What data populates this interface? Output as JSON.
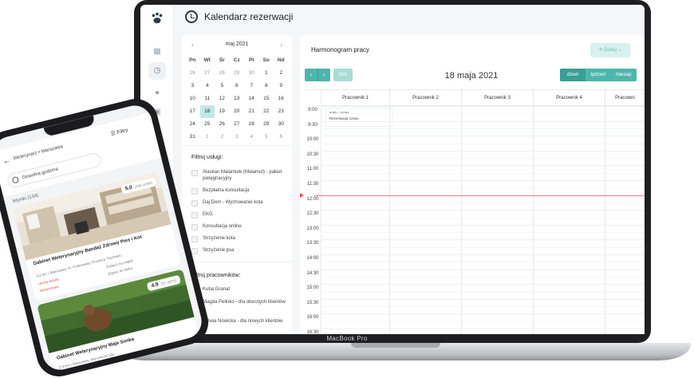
{
  "laptop": {
    "brand": "MacBook Pro",
    "header_title": "Kalendarz rezerwacji",
    "calendar": {
      "month_label": "maj 2021",
      "prev": "‹",
      "next": "›",
      "weekdays": [
        "Pn",
        "Wt",
        "Śr",
        "Cz",
        "Pt",
        "So",
        "Nd"
      ],
      "weeks": [
        [
          "26",
          "27",
          "28",
          "29",
          "30",
          "1",
          "2"
        ],
        [
          "3",
          "4",
          "5",
          "6",
          "7",
          "8",
          "9"
        ],
        [
          "10",
          "11",
          "12",
          "13",
          "14",
          "15",
          "16"
        ],
        [
          "17",
          "18",
          "19",
          "20",
          "21",
          "22",
          "23"
        ],
        [
          "24",
          "25",
          "26",
          "27",
          "28",
          "29",
          "30"
        ],
        [
          "31",
          "1",
          "2",
          "3",
          "4",
          "5",
          "6"
        ]
      ],
      "selected_day": "18"
    },
    "services_filter": {
      "title": "Filtruj usługi:",
      "items": [
        "Alaskan Malamute (Malamut) - pakiet pielęgnacyjny",
        "Bezpłatna konsultacja",
        "Daj Dom - Wychowanie kota",
        "EKG",
        "Konsultacja online",
        "Strzyżenie kota",
        "Strzyżenie psa"
      ]
    },
    "staff_filter": {
      "title": "Filtruj pracowników:",
      "items": [
        "Kuba Granat",
        "Magda Pelinko - dla obecnych klientów",
        "Sylwia Nowicka - dla nowych klientów"
      ]
    },
    "schedule": {
      "title": "Harmonogram pracy",
      "add_label": "Dodaj",
      "prev": "‹",
      "next": "›",
      "today_label": "dziś",
      "date_title": "18 maja 2021",
      "views": [
        "dzień",
        "tydzień",
        "miesiąc"
      ],
      "active_view": "dzień",
      "columns": [
        "Pracownik 1",
        "Pracownik 2",
        "Pracownik 3",
        "Pracownik 4",
        "Pracowni"
      ],
      "times": [
        "9:00",
        "9:30",
        "10:00",
        "10:30",
        "11:00",
        "11:30",
        "12:00",
        "12:30",
        "13:00",
        "13:30",
        "14:00",
        "14:30",
        "15:00",
        "15:30",
        "16:00",
        "16:30"
      ],
      "event": {
        "time": "9:00 - 10:00",
        "label": "Rezerwacja czasu"
      }
    }
  },
  "phone": {
    "breadcrumb": "Weterynarz • Warszawa",
    "filters_label": "Filtry",
    "time_pill": "Dowolna godzina",
    "results": "Wyniki (134)",
    "cards": [
      {
        "rating": "5.0",
        "reviews": "(343 opinii)",
        "name": "Gabinet Weterynaryjny Bandaż Zdrowy Pies i Kot",
        "address": "3,2 km • Warszawa, Al. Krakowska, Prostsza Tiszówka...",
        "tags": [
          "Umów wizytę",
          "Zobacz na mapie",
          "Weterynaria",
          "Zapisz do klubu"
        ]
      },
      {
        "rating": "4.9",
        "reviews": "(21 opinii)",
        "name": "Gabinet Weterynaryjny Maja Sonka",
        "address": "2,3 km • Warszawa, Woronicza 12a"
      }
    ]
  },
  "colors": {
    "accent": "#4db6ac",
    "accent_dark": "#3a9e94",
    "selected_day": "#bfe9e6",
    "now_line": "#e87f7f"
  }
}
